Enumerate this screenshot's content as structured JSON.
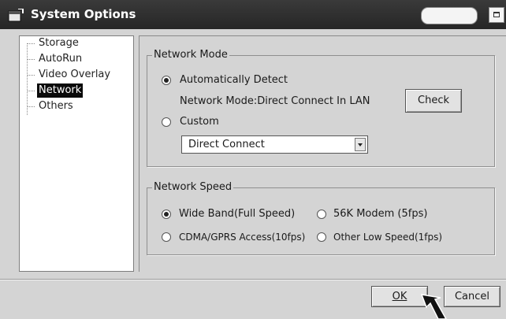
{
  "window": {
    "title": "System Options"
  },
  "tree": {
    "items": [
      {
        "label": "Storage"
      },
      {
        "label": "AutoRun"
      },
      {
        "label": "Video Overlay"
      },
      {
        "label": "Network",
        "selected": true
      },
      {
        "label": "Others"
      }
    ]
  },
  "network_mode": {
    "legend": "Network Mode",
    "auto_label": "Automatically Detect",
    "auto_checked": true,
    "status_text": "Network Mode:Direct Connect In LAN",
    "check_label": "Check",
    "custom_label": "Custom",
    "custom_checked": false,
    "custom_select_value": "Direct Connect"
  },
  "network_speed": {
    "legend": "Network Speed",
    "options": [
      {
        "label": "Wide Band(Full Speed)",
        "checked": true
      },
      {
        "label": "56K Modem (5fps)",
        "checked": false
      },
      {
        "label": "CDMA/GPRS Access(10fps)",
        "checked": false
      },
      {
        "label": "Other Low Speed(1fps)",
        "checked": false
      }
    ]
  },
  "footer": {
    "ok_label": "OK",
    "cancel_label": "Cancel"
  },
  "icons": {
    "app": "app-window-icon",
    "maximize": "maximize-icon",
    "dropdown": "chevron-down-icon",
    "pointer": "mouse-pointer-icon"
  }
}
